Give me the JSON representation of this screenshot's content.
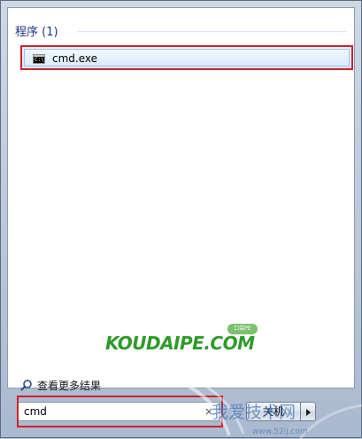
{
  "results": {
    "group_header": "程序 (1)",
    "items": [
      {
        "label": "cmd.exe",
        "icon": "command-prompt-icon"
      }
    ]
  },
  "watermark": {
    "logo_text": "KOUDAIPE.COM",
    "badge_text": "口袋PE"
  },
  "see_more": {
    "label": "查看更多结果",
    "icon": "magnifier-icon"
  },
  "search": {
    "value": "cmd",
    "clear_glyph": "×"
  },
  "shutdown": {
    "label": "关机"
  },
  "corner_watermark": {
    "text": "我爱技术网",
    "url": "www.52ij.com"
  },
  "colors": {
    "highlight_red": "#d0202a",
    "group_header_blue": "#1e3287",
    "logo_green": "#2f9a2a"
  }
}
